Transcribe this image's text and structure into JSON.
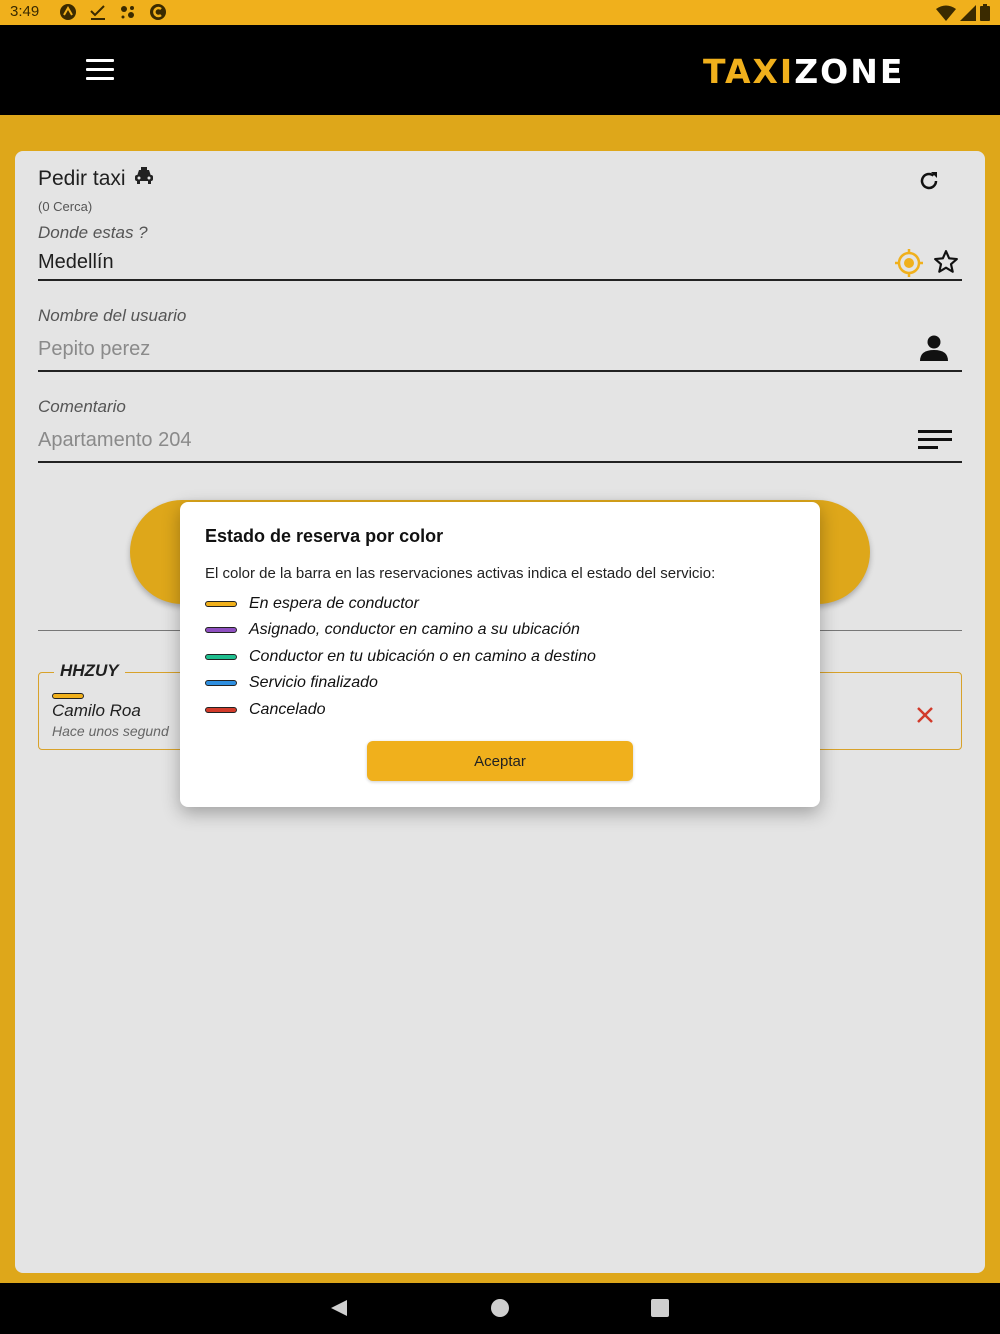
{
  "status_bar": {
    "time": "3:49",
    "left_icons": [
      "a-icon",
      "check-icon",
      "assistant-icon",
      "circle-c-icon"
    ],
    "right_icons": [
      "wifi-icon",
      "signal-icon",
      "battery-icon"
    ]
  },
  "app_bar": {
    "logo_part1": "TAXI",
    "logo_part2": "ZONE",
    "menu_icon": "hamburger-icon"
  },
  "colors": {
    "accent": "#f0b01c",
    "band": "#dea71a",
    "purple": "#8e4fc0",
    "green": "#1fbf8f",
    "blue": "#2e8fe0",
    "red": "#d23a2a"
  },
  "form": {
    "title": "Pedir taxi",
    "near_count": "(0 Cerca)",
    "location_label": "Donde estas ?",
    "location_value": "Medellín",
    "user_label": "Nombre del usuario",
    "user_placeholder": "Pepito perez",
    "comment_label": "Comentario",
    "comment_placeholder": "Apartamento 204"
  },
  "reservation": {
    "code": "HHZUY",
    "driver": "Camilo Roa",
    "time": "Hace unos segund"
  },
  "dialog": {
    "title": "Estado de reserva por color",
    "description": "El color de la barra en las reservaciones activas indica el estado del servicio:",
    "legend": [
      {
        "label": "En espera de conductor",
        "color": "#f0b01c"
      },
      {
        "label": "Asignado, conductor en camino a su ubicación",
        "color": "#8e4fc0"
      },
      {
        "label": "Conductor en tu ubicación o en camino a destino",
        "color": "#1fbf8f"
      },
      {
        "label": "Servicio finalizado",
        "color": "#2e8fe0"
      },
      {
        "label": "Cancelado",
        "color": "#d23a2a"
      }
    ],
    "accept_label": "Aceptar"
  }
}
